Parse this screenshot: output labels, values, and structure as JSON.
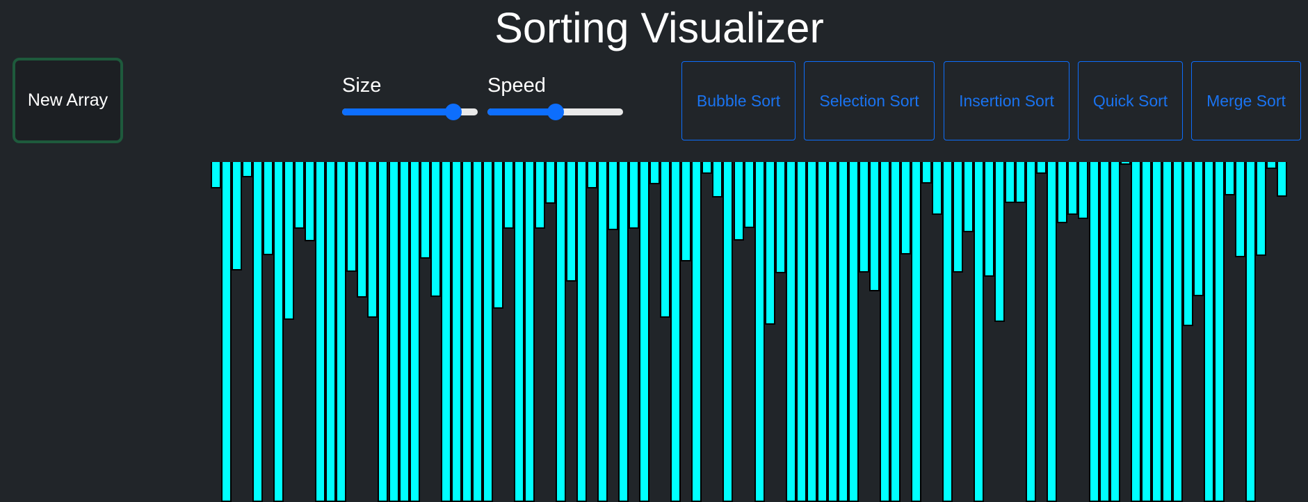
{
  "app": {
    "title": "Sorting Visualizer"
  },
  "controls": {
    "new_array_label": "New Array",
    "size": {
      "label": "Size",
      "value_fraction": 0.82
    },
    "speed": {
      "label": "Speed",
      "value_fraction": 0.5
    }
  },
  "algorithms": [
    {
      "label": "Bubble Sort"
    },
    {
      "label": "Selection Sort"
    },
    {
      "label": "Insertion Sort"
    },
    {
      "label": "Quick Sort"
    },
    {
      "label": "Merge Sort"
    }
  ],
  "colors": {
    "background": "#212529",
    "bar": "#00ffff",
    "accent": "#0d6efd",
    "new_array_border": "#1e5a3c"
  },
  "array": {
    "values": [
      78,
      1000,
      320,
      45,
      1000,
      275,
      1000,
      465,
      197,
      233,
      1000,
      1000,
      1000,
      324,
      399,
      458,
      1000,
      1000,
      1000,
      1000,
      284,
      396,
      1000,
      1000,
      1000,
      1000,
      1000,
      431,
      196,
      1000,
      1000,
      196,
      122,
      1000,
      352,
      1000,
      77,
      1000,
      200,
      1000,
      197,
      1000,
      66,
      459,
      1000,
      293,
      1000,
      35,
      105,
      1000,
      231,
      195,
      1000,
      478,
      327,
      1000,
      1000,
      1000,
      1000,
      1000,
      1000,
      1000,
      326,
      380,
      1000,
      1000,
      273,
      1000,
      63,
      156,
      1000,
      326,
      207,
      1000,
      338,
      471,
      120,
      121,
      1000,
      35,
      1000,
      180,
      155,
      167,
      1000,
      1000,
      1000,
      9,
      1000,
      1000,
      1000,
      1000,
      1000,
      482,
      395,
      1000,
      1000,
      99,
      280,
      1000,
      277,
      20,
      102
    ]
  }
}
